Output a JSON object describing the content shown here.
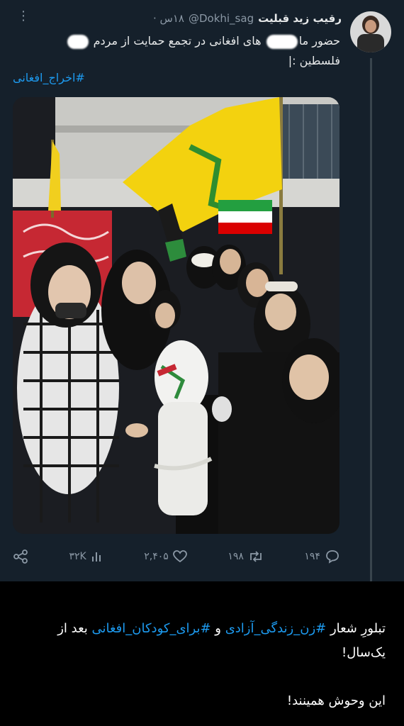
{
  "tweet": {
    "display_name": "رقیب زید قبلیت",
    "handle": "@Dokhi_sag",
    "time": "۱۸س ·",
    "text_part1": "حضور ما",
    "text_part2": " های افغانی در تجمع حمایت از مردم ",
    "text_part3": "فلسطین :|",
    "hashtag": "#اخراج_افغانی",
    "actions": {
      "replies": "۱۹۴",
      "retweets": "۱۹۸",
      "likes": "۲,۴۰۵",
      "views": "۳۲K"
    }
  },
  "caption": {
    "line1_a": "تبلورِ شعار ",
    "tag1": "#زن_زندگی_آزادی",
    "line1_b": " و ",
    "tag2": "#برای_کودکان_افغانی",
    "line1_c": " بعد از یک‌سال!",
    "line2": "این وحوش همینند!"
  },
  "colors": {
    "background": "#15202b",
    "link": "#1d9bf0",
    "muted": "#8b98a5"
  }
}
